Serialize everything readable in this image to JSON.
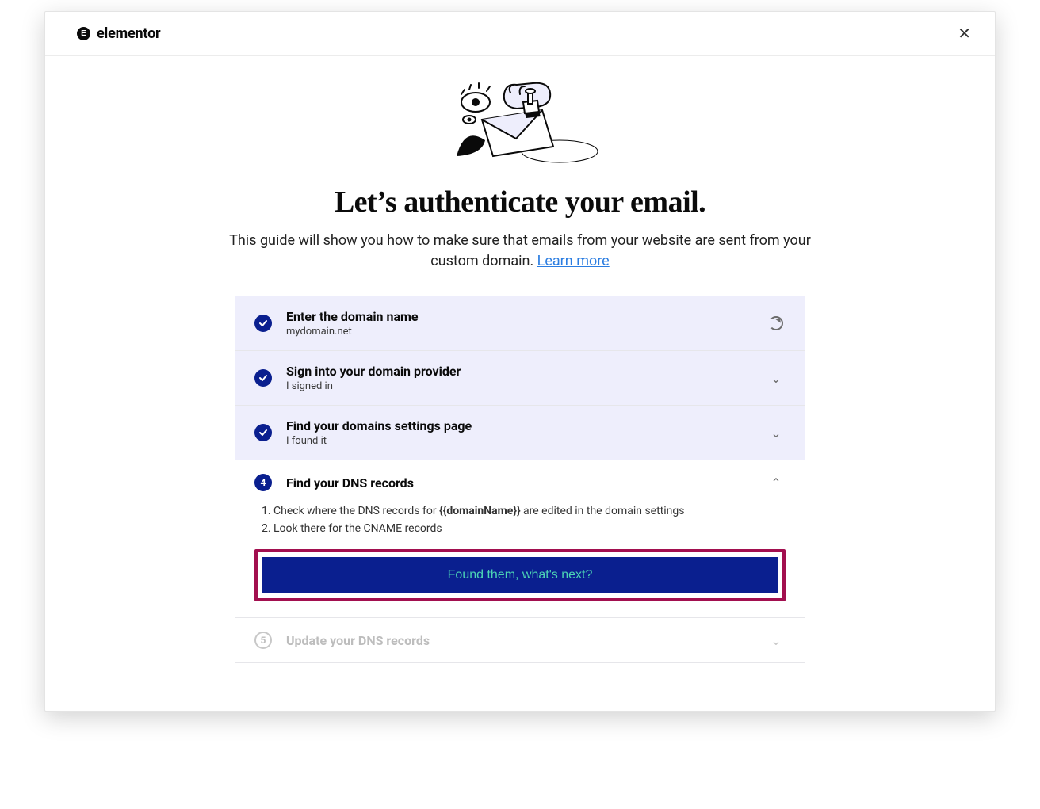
{
  "brand": {
    "badge": "E",
    "name": "elementor"
  },
  "header": {
    "close_aria": "Close"
  },
  "hero": {
    "title": "Let’s authenticate your email.",
    "subtitle_before_link": "This guide will show you how to make sure that emails from your website are sent from your custom domain. ",
    "link_text": "Learn more"
  },
  "steps": [
    {
      "status": "completed",
      "title": "Enter the domain name",
      "subtitle": "mydomain.net",
      "action": "refresh"
    },
    {
      "status": "completed",
      "title": "Sign into your domain provider",
      "subtitle": "I signed in",
      "action": "chevron-down"
    },
    {
      "status": "completed",
      "title": "Find your domains settings page",
      "subtitle": "I found it",
      "action": "chevron-down"
    },
    {
      "status": "active",
      "number": "4",
      "title": "Find your DNS records",
      "action": "chevron-up",
      "body": {
        "list_item1_before": "Check where the DNS records for ",
        "list_item1_bold": "{{domainName}}",
        "list_item1_after": " are edited in the domain settings",
        "list_item2": "Look there for the CNAME records",
        "cta": "Found them, what's next?"
      }
    },
    {
      "status": "pending",
      "number": "5",
      "title": "Update your DNS records",
      "action": "chevron-down"
    }
  ]
}
